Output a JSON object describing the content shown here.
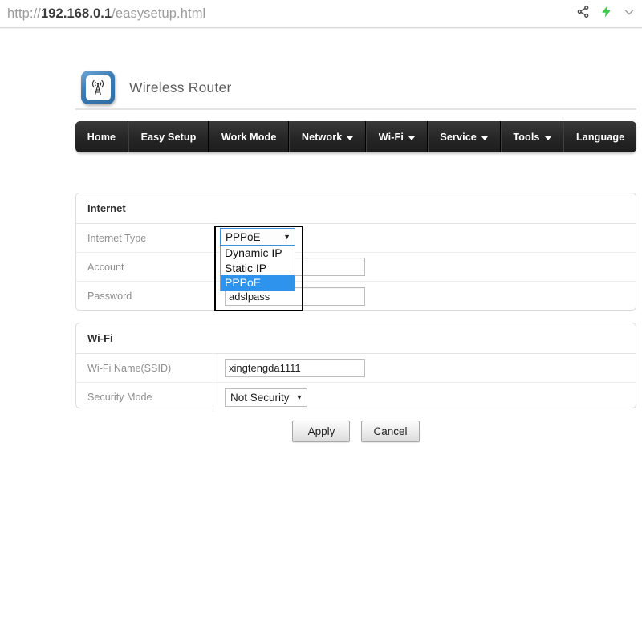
{
  "browser": {
    "url_scheme": "http://",
    "url_host": "192.168.0.1",
    "url_path": "/easysetup.html",
    "icons": [
      {
        "name": "share-icon",
        "label": "share"
      },
      {
        "name": "lightning-bolt-icon",
        "label": "turbo",
        "color": "#3cc84a"
      },
      {
        "name": "chevron-down-icon",
        "label": "more"
      }
    ]
  },
  "header": {
    "title": "Wireless Router",
    "logo_icon": "wireless-router-antenna-icon",
    "logo_color": "#3d7cb4"
  },
  "nav": {
    "items": [
      {
        "label": "Home",
        "caret": false
      },
      {
        "label": "Easy Setup",
        "caret": false
      },
      {
        "label": "Work Mode",
        "caret": false
      },
      {
        "label": "Network",
        "caret": true
      },
      {
        "label": "Wi-Fi",
        "caret": true
      },
      {
        "label": "Service",
        "caret": true
      },
      {
        "label": "Tools",
        "caret": true
      },
      {
        "label": "Language",
        "caret": false
      }
    ]
  },
  "internet": {
    "title": "Internet",
    "rows": [
      {
        "label": "Internet Type",
        "value": "PPPoE",
        "control": "select"
      },
      {
        "label": "Account",
        "value": "",
        "control": "text",
        "placeholder": ""
      },
      {
        "label": "Password",
        "value": "adslpass",
        "control": "text",
        "placeholder": ""
      }
    ],
    "internet_type_dropdown": {
      "open": true,
      "selected": "PPPoE",
      "arrow": "▼",
      "options": [
        {
          "label": "Dynamic IP",
          "selected": false
        },
        {
          "label": "Static IP",
          "selected": false
        },
        {
          "label": "PPPoE",
          "selected": true
        }
      ],
      "highlight_color": "#2e93ec"
    }
  },
  "wifi": {
    "title": "Wi-Fi",
    "rows": [
      {
        "label": "Wi-Fi Name(SSID)",
        "value": "xingtengda1111",
        "control": "text",
        "placeholder": ""
      },
      {
        "label": "Security Mode",
        "value": "Not Security",
        "control": "select",
        "arrow": "▼"
      }
    ]
  },
  "actions": {
    "apply_label": "Apply",
    "cancel_label": "Cancel"
  }
}
